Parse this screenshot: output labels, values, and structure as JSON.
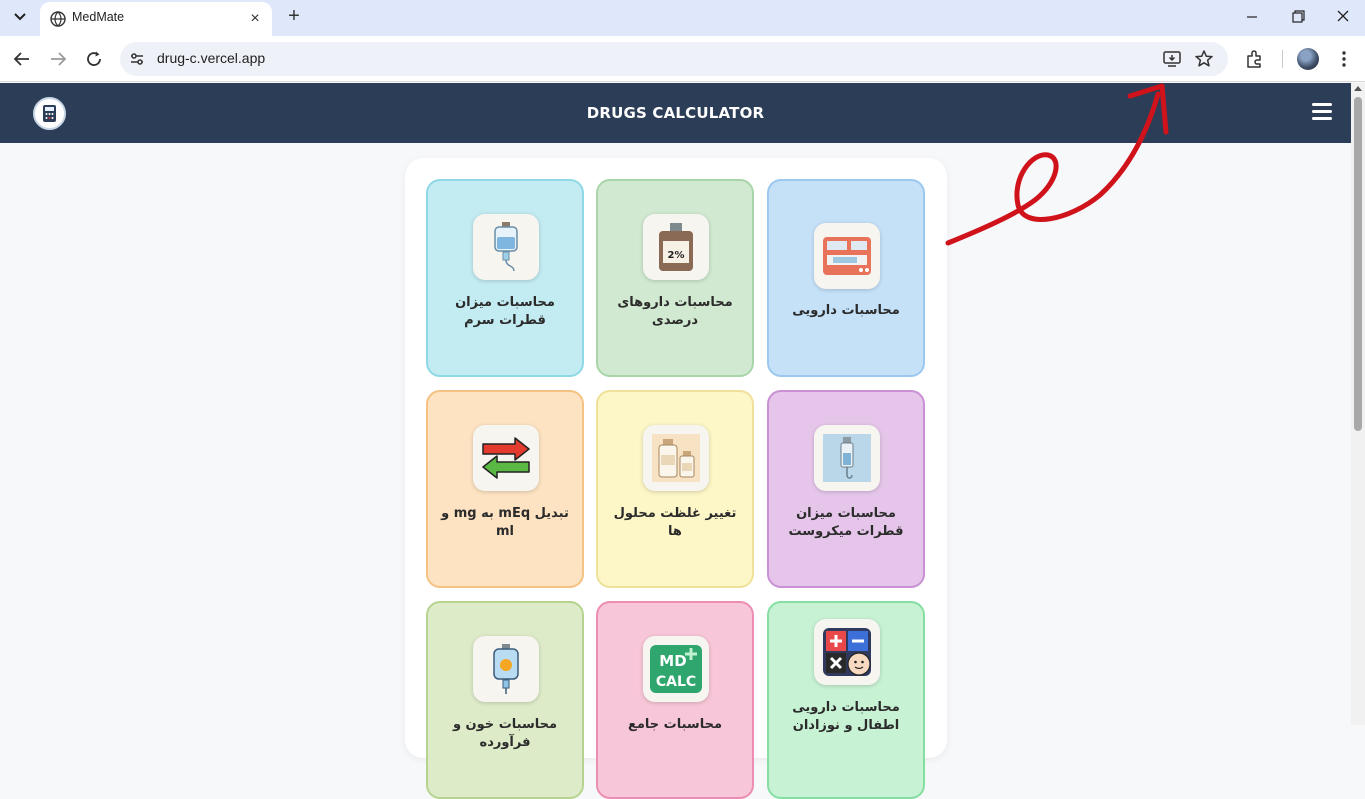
{
  "browser": {
    "tab_title": "MedMate",
    "url": "drug-c.vercel.app",
    "new_tab_label": "+",
    "close_tab_label": "×"
  },
  "app": {
    "title": "DRUGS CALCULATOR"
  },
  "cards": [
    {
      "label": "محاسبات دارویی",
      "icon": "infusion-pump-icon"
    },
    {
      "label": "محاسبات داروهای درصدی",
      "icon": "lidocaine-vial-icon",
      "icon_text": "2%"
    },
    {
      "label": "محاسبات میزان قطرات سرم",
      "icon": "iv-bag-icon"
    },
    {
      "label": "محاسبات میزان قطرات میکروست",
      "icon": "microset-icon"
    },
    {
      "label": "تغییر غلظت محلول ها",
      "icon": "solution-bottles-icon"
    },
    {
      "label": "تبدیل mEq به mg و ml",
      "icon": "swap-arrows-icon"
    },
    {
      "label": "محاسبات دارویی اطفال و نوزادان",
      "icon": "pediatric-calc-icon"
    },
    {
      "label": "محاسبات جامع",
      "icon": "mdcalc-icon",
      "icon_text": "MD CALC"
    },
    {
      "label": "محاسبات خون و فرآورده",
      "icon": "blood-bag-icon"
    }
  ],
  "colors": {
    "header_bg": "#2c3e57",
    "card_blue": "#c5e1f8",
    "card_green": "#d0e9d0",
    "card_cyan": "#c2ebf2",
    "card_purple": "#e5c6ea",
    "card_yellow": "#fdf6c6",
    "card_orange": "#fde3c2",
    "card_mint": "#c7f2d4",
    "card_pink": "#f7c6d8",
    "card_lime": "#ddebc9",
    "annotation_red": "#d0121b"
  }
}
